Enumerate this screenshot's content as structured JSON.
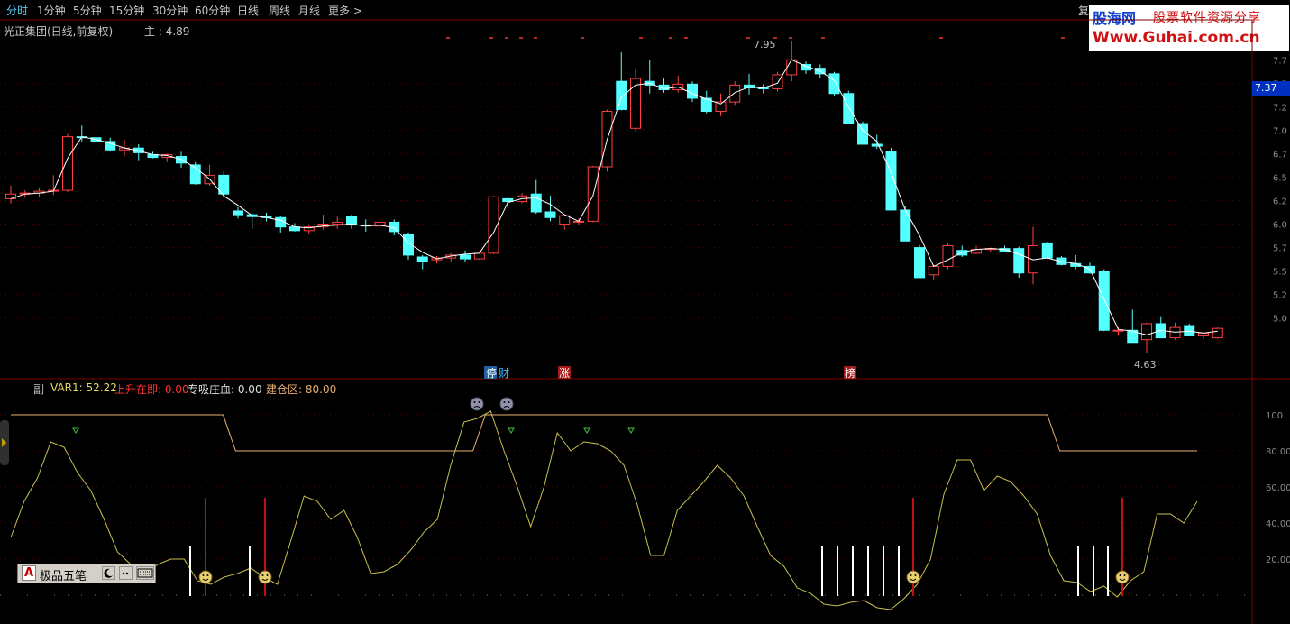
{
  "toolbar": {
    "items": [
      "分时",
      "1分钟",
      "5分钟",
      "15分钟",
      "30分钟",
      "60分钟",
      "日线",
      "周线",
      "月线",
      "更多 >"
    ],
    "right_label": "复"
  },
  "logo": {
    "name": "股海网",
    "slogan": "股票软件资源分享",
    "url": "Www.Guhai.com.cn"
  },
  "header": {
    "stock_title": "光正集团(日线,前复权)",
    "main_label": "主 : 4.89"
  },
  "current_price": "7.37",
  "price_axis": [
    "7.7",
    "7.5",
    "7.2",
    "7.0",
    "6.7",
    "6.5",
    "6.2",
    "6.0",
    "5.7",
    "5.5",
    "5.2",
    "5.0"
  ],
  "price_annotations": {
    "high": "7.95",
    "low": "4.63"
  },
  "markers": {
    "stop_profit": "停",
    "cai": "财",
    "zhang": "涨",
    "bang": "榜"
  },
  "indicator": {
    "label": "副",
    "var1": "VAR1: 52.22",
    "rise": "上升在即: 0.00",
    "absorb": "专吸庄血: 0.00",
    "build": "建仓区: 80.00"
  },
  "indicator_axis": [
    "100",
    "80.00",
    "60.00",
    "40.00",
    "20.00"
  ],
  "ime": {
    "badge": "A",
    "name": "极品五笔"
  },
  "colors": {
    "up": "#ff4040",
    "down": "#54ffff",
    "ma": "#ffffff",
    "osc": "#c8c050",
    "band": "#e8b070"
  },
  "chart_data": {
    "type": "candlestick",
    "ohlc": [
      [
        6.27,
        6.41,
        6.22,
        6.32
      ],
      [
        6.32,
        6.36,
        6.28,
        6.33
      ],
      [
        6.33,
        6.38,
        6.29,
        6.35
      ],
      [
        6.35,
        6.52,
        6.31,
        6.36
      ],
      [
        6.36,
        6.96,
        6.34,
        6.93
      ],
      [
        6.93,
        7.05,
        6.88,
        6.92
      ],
      [
        6.92,
        7.24,
        6.65,
        6.88
      ],
      [
        6.88,
        6.92,
        6.77,
        6.79
      ],
      [
        6.79,
        6.9,
        6.72,
        6.81
      ],
      [
        6.81,
        6.85,
        6.68,
        6.76
      ],
      [
        6.74,
        6.77,
        6.7,
        6.71
      ],
      [
        6.71,
        6.75,
        6.66,
        6.74
      ],
      [
        6.72,
        6.77,
        6.6,
        6.65
      ],
      [
        6.63,
        6.66,
        6.42,
        6.43
      ],
      [
        6.43,
        6.63,
        6.41,
        6.52
      ],
      [
        6.52,
        6.56,
        6.28,
        6.32
      ],
      [
        6.14,
        6.18,
        6.06,
        6.1
      ],
      [
        6.1,
        6.12,
        5.95,
        6.08
      ],
      [
        6.08,
        6.12,
        6.03,
        6.07
      ],
      [
        6.07,
        6.09,
        5.91,
        5.97
      ],
      [
        5.97,
        6.01,
        5.92,
        5.93
      ],
      [
        5.93,
        5.99,
        5.9,
        5.97
      ],
      [
        5.97,
        6.1,
        5.94,
        6.0
      ],
      [
        6.0,
        6.08,
        5.95,
        6.02
      ],
      [
        6.08,
        6.1,
        5.95,
        5.99
      ],
      [
        5.99,
        6.05,
        5.92,
        5.98
      ],
      [
        5.98,
        6.07,
        5.93,
        6.02
      ],
      [
        6.02,
        6.05,
        5.88,
        5.92
      ],
      [
        5.89,
        5.91,
        5.62,
        5.67
      ],
      [
        5.65,
        5.67,
        5.52,
        5.6
      ],
      [
        5.62,
        5.66,
        5.58,
        5.64
      ],
      [
        5.64,
        5.69,
        5.6,
        5.67
      ],
      [
        5.67,
        5.72,
        5.6,
        5.63
      ],
      [
        5.63,
        5.69,
        5.62,
        5.69
      ],
      [
        5.69,
        6.3,
        5.68,
        6.29
      ],
      [
        6.27,
        6.29,
        6.17,
        6.24
      ],
      [
        6.24,
        6.33,
        6.22,
        6.3
      ],
      [
        6.32,
        6.47,
        6.11,
        6.13
      ],
      [
        6.13,
        6.3,
        6.03,
        6.07
      ],
      [
        6.0,
        6.08,
        5.94,
        6.09
      ],
      [
        6.02,
        6.06,
        5.99,
        6.03
      ],
      [
        6.03,
        6.62,
        6.02,
        6.61
      ],
      [
        6.61,
        7.22,
        6.56,
        7.2
      ],
      [
        7.52,
        7.83,
        7.21,
        7.22
      ],
      [
        7.02,
        7.65,
        6.99,
        7.55
      ],
      [
        7.52,
        7.75,
        7.39,
        7.48
      ],
      [
        7.48,
        7.55,
        7.4,
        7.43
      ],
      [
        7.43,
        7.58,
        7.4,
        7.49
      ],
      [
        7.49,
        7.52,
        7.3,
        7.34
      ],
      [
        7.34,
        7.42,
        7.18,
        7.2
      ],
      [
        7.2,
        7.39,
        7.15,
        7.3
      ],
      [
        7.3,
        7.52,
        7.27,
        7.48
      ],
      [
        7.48,
        7.6,
        7.38,
        7.45
      ],
      [
        7.45,
        7.49,
        7.39,
        7.44
      ],
      [
        7.44,
        7.62,
        7.41,
        7.59
      ],
      [
        7.59,
        7.95,
        7.52,
        7.75
      ],
      [
        7.7,
        7.73,
        7.6,
        7.64
      ],
      [
        7.66,
        7.7,
        7.55,
        7.6
      ],
      [
        7.6,
        7.62,
        7.37,
        7.39
      ],
      [
        7.39,
        7.42,
        7.11,
        7.07
      ],
      [
        7.07,
        7.09,
        6.85,
        6.85
      ],
      [
        6.85,
        6.95,
        6.8,
        6.83
      ],
      [
        6.77,
        6.81,
        6.15,
        6.15
      ],
      [
        6.15,
        6.19,
        5.82,
        5.82
      ],
      [
        5.75,
        5.78,
        5.44,
        5.43
      ],
      [
        5.46,
        5.57,
        5.4,
        5.55
      ],
      [
        5.55,
        5.8,
        5.52,
        5.77
      ],
      [
        5.72,
        5.77,
        5.65,
        5.67
      ],
      [
        5.69,
        5.77,
        5.68,
        5.73
      ],
      [
        5.73,
        5.75,
        5.7,
        5.74
      ],
      [
        5.74,
        5.77,
        5.7,
        5.71
      ],
      [
        5.74,
        5.76,
        5.43,
        5.48
      ],
      [
        5.48,
        5.97,
        5.36,
        5.77
      ],
      [
        5.8,
        5.81,
        5.63,
        5.64
      ],
      [
        5.64,
        5.66,
        5.56,
        5.57
      ],
      [
        5.58,
        5.67,
        5.52,
        5.55
      ],
      [
        5.55,
        5.59,
        5.47,
        5.48
      ],
      [
        5.5,
        5.52,
        4.86,
        4.87
      ],
      [
        4.87,
        4.9,
        4.81,
        4.87
      ],
      [
        4.87,
        5.09,
        4.8,
        4.74
      ],
      [
        4.77,
        4.95,
        4.63,
        4.94
      ],
      [
        4.94,
        5.02,
        4.91,
        4.79
      ],
      [
        4.79,
        4.95,
        4.77,
        4.9
      ],
      [
        4.92,
        4.94,
        4.83,
        4.81
      ],
      [
        4.81,
        4.84,
        4.78,
        4.84
      ],
      [
        4.79,
        4.9,
        4.78,
        4.89
      ]
    ],
    "ma": [
      6.27,
      6.32,
      6.33,
      6.35,
      6.7,
      6.93,
      6.9,
      6.86,
      6.81,
      6.78,
      6.74,
      6.73,
      6.69,
      6.6,
      6.48,
      6.3,
      6.2,
      6.09,
      6.07,
      6.04,
      5.97,
      5.96,
      5.98,
      5.99,
      6.0,
      5.98,
      5.99,
      5.96,
      5.8,
      5.7,
      5.63,
      5.66,
      5.68,
      5.69,
      5.91,
      6.23,
      6.27,
      6.28,
      6.21,
      6.1,
      6.03,
      6.3,
      6.9,
      7.35,
      7.48,
      7.5,
      7.44,
      7.46,
      7.39,
      7.33,
      7.28,
      7.4,
      7.46,
      7.45,
      7.5,
      7.75,
      7.68,
      7.63,
      7.53,
      7.25,
      7.0,
      6.88,
      6.55,
      6.15,
      5.88,
      5.55,
      5.62,
      5.7,
      5.73,
      5.74,
      5.73,
      5.68,
      5.62,
      5.64,
      5.6,
      5.58,
      5.52,
      5.2,
      4.88,
      4.86,
      4.82,
      4.87,
      4.85,
      4.86,
      4.84,
      4.86
    ],
    "oscillator": [
      32,
      52,
      65,
      85,
      82,
      68,
      58,
      42,
      24,
      17,
      10,
      17,
      20,
      20,
      8,
      6,
      10,
      12,
      15,
      10,
      6,
      30,
      55,
      52,
      42,
      47,
      32,
      12,
      13,
      17,
      25,
      35,
      42,
      72,
      96,
      98,
      102,
      80,
      60,
      38,
      60,
      90,
      80,
      85,
      84,
      80,
      72,
      50,
      22,
      22,
      47,
      55,
      63,
      72,
      65,
      55,
      38,
      22,
      16,
      4,
      1,
      -5,
      -6,
      -4,
      -3,
      -7,
      -8,
      -2,
      6,
      20,
      56,
      75,
      75,
      58,
      66,
      63,
      55,
      45,
      22,
      8,
      7,
      2,
      5,
      -1,
      8,
      13,
      45,
      45,
      40,
      52
    ],
    "band": [
      100,
      100,
      100,
      100,
      100,
      100,
      100,
      100,
      100,
      100,
      100,
      100,
      100,
      100,
      100,
      100,
      100,
      100,
      80,
      80,
      80,
      80,
      80,
      80,
      80,
      80,
      80,
      80,
      80,
      80,
      80,
      80,
      80,
      80,
      80,
      80,
      80,
      80,
      100,
      100,
      100,
      100,
      100,
      100,
      100,
      100,
      100,
      100,
      100,
      100,
      100,
      100,
      100,
      100,
      100,
      100,
      100,
      100,
      100,
      100,
      100,
      100,
      100,
      100,
      100,
      100,
      100,
      100,
      100,
      100,
      100,
      100,
      100,
      100,
      100,
      100,
      100,
      100,
      100,
      100,
      100,
      100,
      100,
      100,
      80,
      80,
      80,
      80,
      80,
      80,
      80,
      80,
      80,
      80,
      80,
      80
    ],
    "price_ylim": [
      4.45,
      8.05
    ],
    "osc_ylim": [
      -10,
      110
    ]
  }
}
